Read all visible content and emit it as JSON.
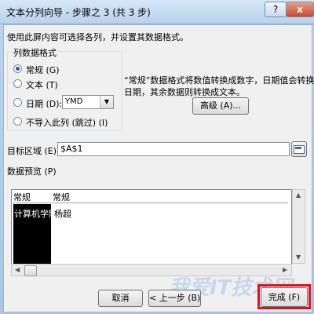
{
  "window": {
    "title": "文本分列向导 - 步骤之 3 (共 3 步)",
    "help_glyph": "?",
    "close_glyph": "x"
  },
  "intro": "使用此屏内容可选择各列，并设置其数据格式。",
  "column_format": {
    "group_label": "列数据格式",
    "options": [
      {
        "label": "常规 (G)",
        "selected": true
      },
      {
        "label": "文本 (T)",
        "selected": false
      },
      {
        "label": "日期 (D):",
        "selected": false
      },
      {
        "label": "不导入此列 (跳过) (I)",
        "selected": false
      }
    ],
    "date_format_value": "YMD"
  },
  "description_lines": [
    "“常规”数据格式将数值转换成数字，日期值会转换成",
    "日期，其余数据则转换成文本。"
  ],
  "advanced_button": "高级 (A)...",
  "destination": {
    "label": "目标区域 (E):",
    "value": "$A$1"
  },
  "preview": {
    "label": "数据预览 (P)",
    "headers": [
      "常规",
      "常规"
    ],
    "rows": [
      [
        "计算机学院",
        "杨超"
      ]
    ]
  },
  "buttons": {
    "cancel": "取消",
    "back": "< 上一步 (B)",
    "finish": "完成 (F)"
  },
  "watermark": "我爱IT技术网"
}
